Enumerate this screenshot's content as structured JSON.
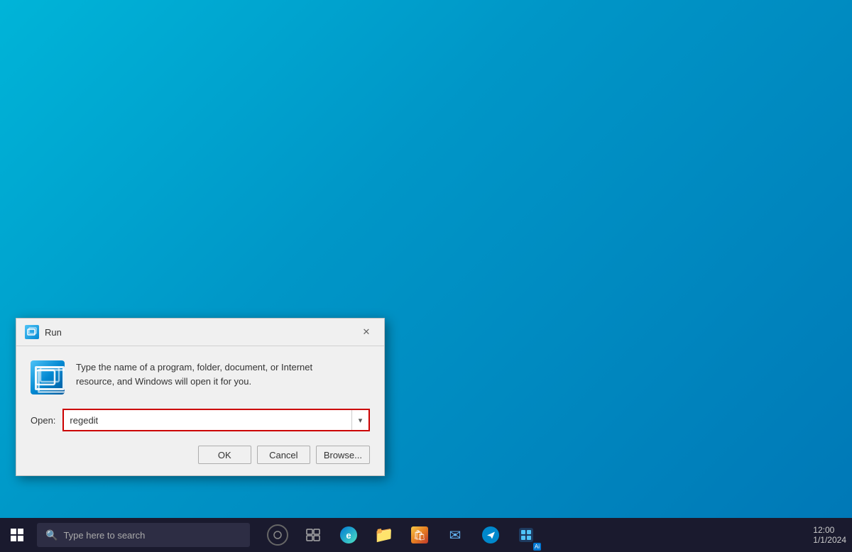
{
  "desktop": {
    "background_color": "#00aad4"
  },
  "run_dialog": {
    "title": "Run",
    "description_line1": "Type the name of a program, folder, document, or Internet",
    "description_line2": "resource, and Windows will open it for you.",
    "open_label": "Open:",
    "input_value": "regedit",
    "buttons": {
      "ok": "OK",
      "cancel": "Cancel",
      "browse": "Browse..."
    }
  },
  "taskbar": {
    "search_placeholder": "Type here to search",
    "icons": [
      {
        "name": "cortana",
        "label": "Search"
      },
      {
        "name": "task-view",
        "label": "Task View"
      },
      {
        "name": "edge",
        "label": "Microsoft Edge"
      },
      {
        "name": "file-explorer",
        "label": "File Explorer"
      },
      {
        "name": "store",
        "label": "Microsoft Store"
      },
      {
        "name": "mail",
        "label": "Mail"
      },
      {
        "name": "telegram",
        "label": "Telegram"
      },
      {
        "name": "agent",
        "label": "Agent"
      }
    ],
    "ai_badge_text": "Ai"
  }
}
